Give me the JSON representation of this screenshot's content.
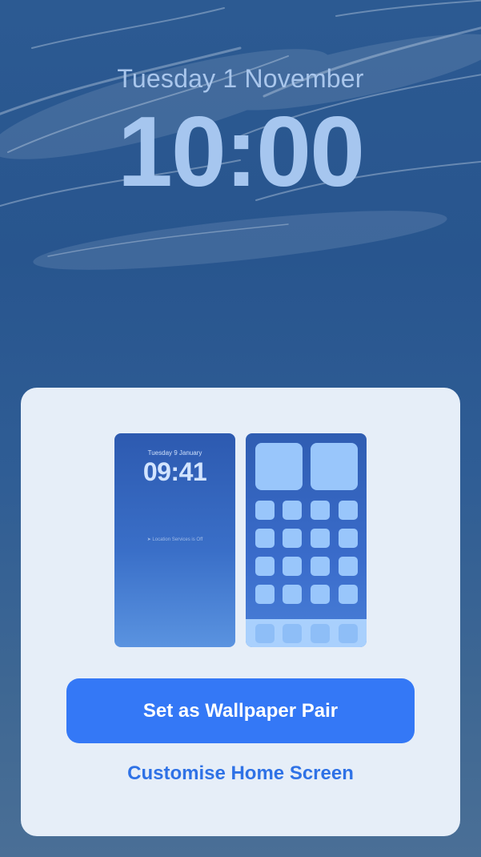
{
  "lock_screen": {
    "date": "Tuesday 1 November",
    "time": "10:00"
  },
  "sheet": {
    "lock_preview": {
      "date": "Tuesday 9 January",
      "time": "09:41",
      "location_note": "Location Services is Off"
    },
    "primary_button_label": "Set as Wallpaper Pair",
    "secondary_link_label": "Customise Home Screen"
  },
  "colors": {
    "accent": "#3478f6",
    "link": "#2f72e6",
    "sheet_bg": "#e6eef8",
    "app_icon": "#99c6fb"
  }
}
